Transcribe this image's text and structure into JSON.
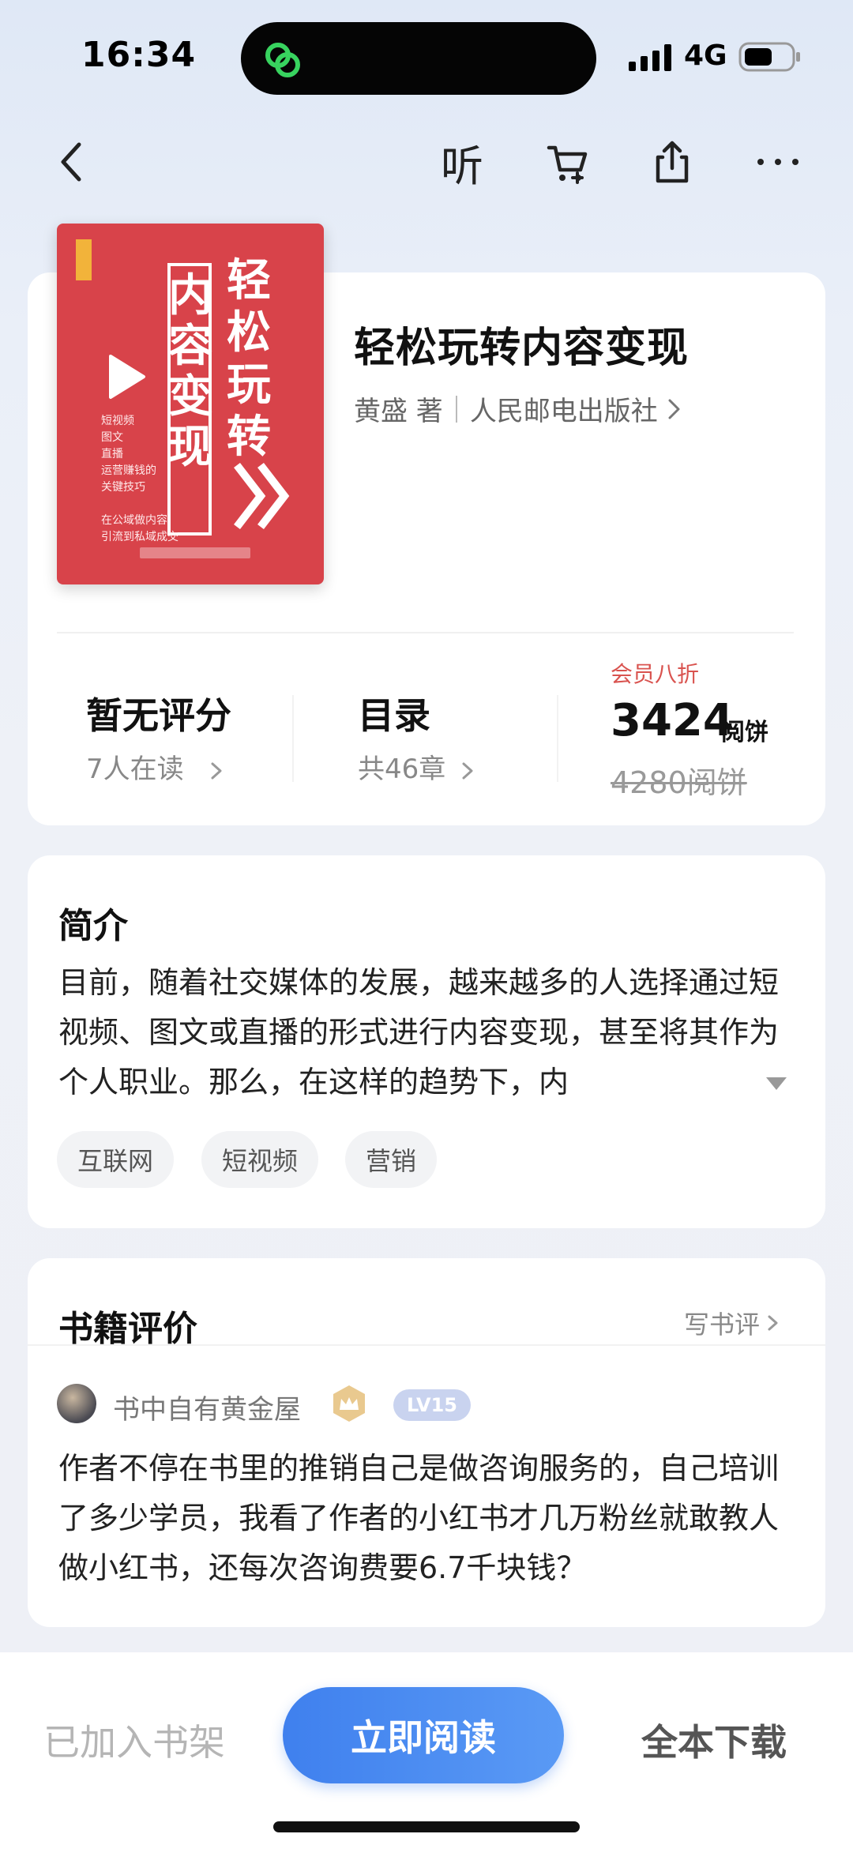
{
  "status_bar": {
    "time": "16:34",
    "network": "4G"
  },
  "nav": {
    "listen_label": "听"
  },
  "book": {
    "title": "轻松玩转内容变现",
    "author": "黄盛 著",
    "publisher": "人民邮电出版社",
    "cover": {
      "title_vertical_1": "内容变现",
      "title_vertical_2": "轻松玩转",
      "blurb": [
        "短视频",
        "图文",
        "直播",
        "运营赚钱的",
        "关键技巧",
        "",
        "在公域做内容",
        "引流到私域成交"
      ]
    }
  },
  "stats": {
    "rating": "暂无评分",
    "readers": "7人在读",
    "toc": "目录",
    "chapters": "共46章",
    "member_label": "会员八折",
    "price_now": "3424",
    "price_unit": "阅饼",
    "price_old": "4280阅饼"
  },
  "intro": {
    "title": "简介",
    "text": "目前，随着社交媒体的发展，越来越多的人选择通过短视频、图文或直播的形式进行内容变现，甚至将其作为个人职业。那么，在这样的趋势下，内",
    "tags": [
      "互联网",
      "短视频",
      "营销"
    ]
  },
  "reviews": {
    "title": "书籍评价",
    "write_label": "写书评",
    "items": [
      {
        "user": "书中自有黄金屋",
        "level": "LV15",
        "text": "作者不停在书里的推销自己是做咨询服务的，自己培训了多少学员，我看了作者的小红书才几万粉丝就敢教人做小红书，还每次咨询费要6.7千块钱？"
      }
    ]
  },
  "bottom_bar": {
    "shelf_label": "已加入书架",
    "read_label": "立即阅读",
    "download_label": "全本下载"
  },
  "colors": {
    "accent": "#3f80ee",
    "member": "#d9534f",
    "cover": "#d8434a"
  },
  "icons": [
    "back-arrow-icon",
    "cart-icon",
    "share-icon",
    "more-icon",
    "chevron-right-icon",
    "expand-icon",
    "crown-icon"
  ]
}
